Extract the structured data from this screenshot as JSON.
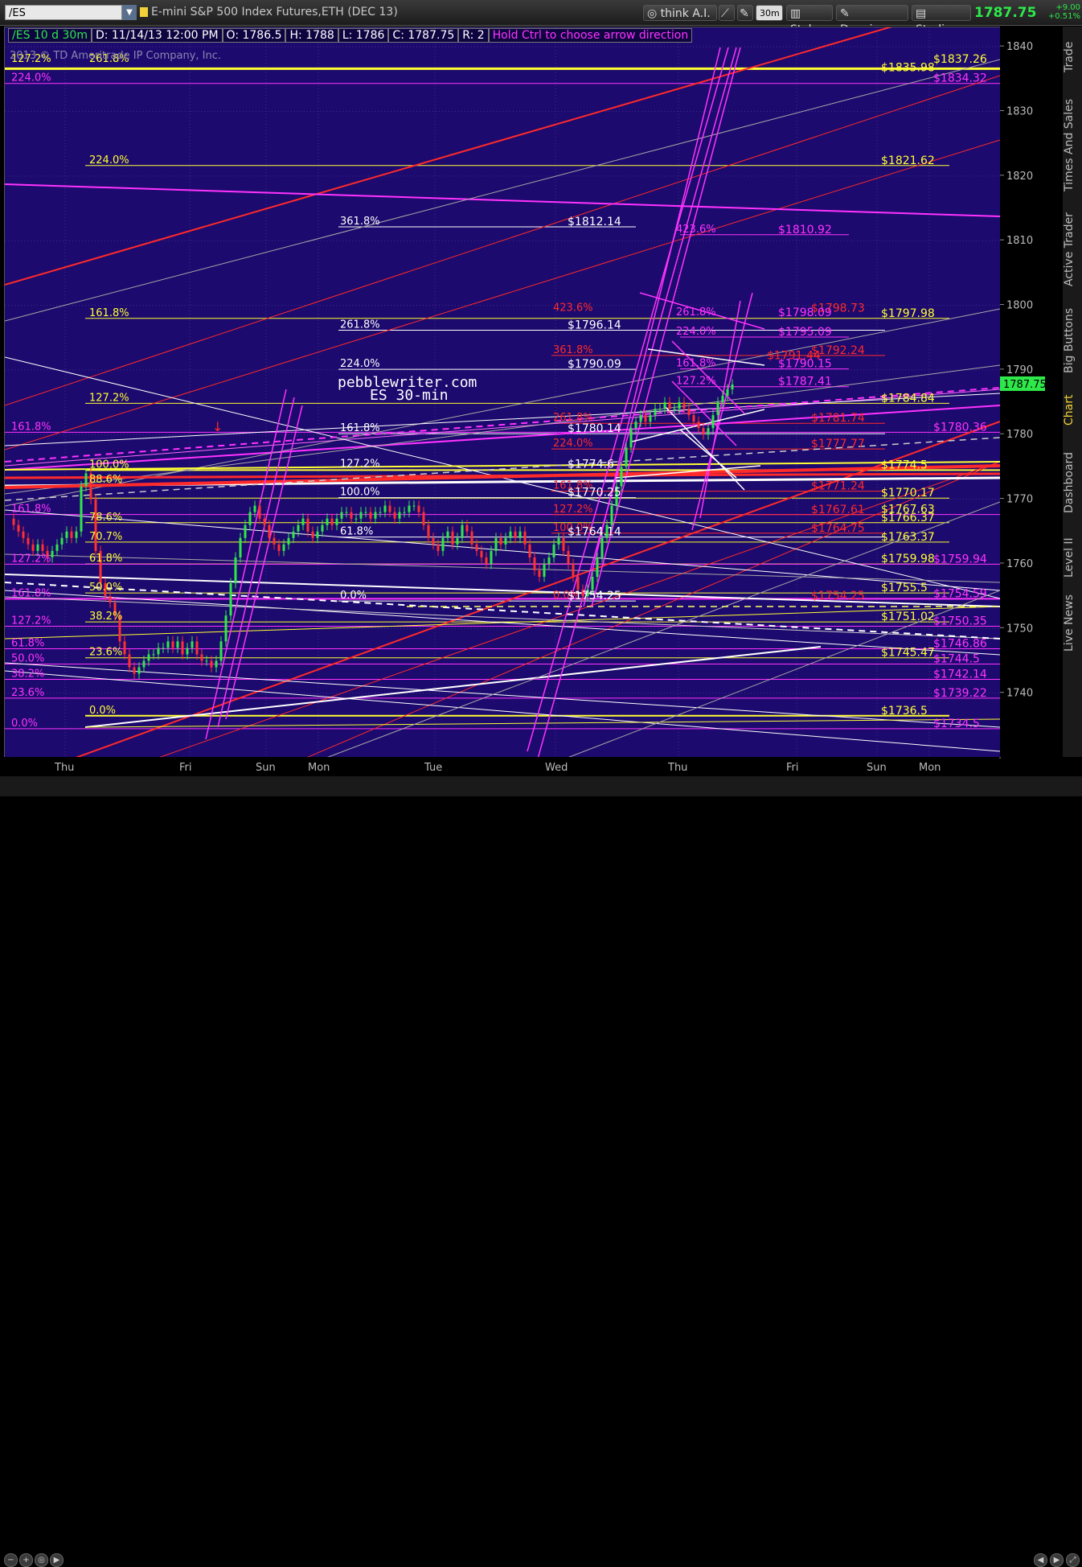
{
  "toolbar": {
    "symbol": "/ES",
    "instrument_title": "E-mini S&P 500 Index Futures,ETH (DEC 13)",
    "think_ai": "think A.I.",
    "zoom": "30m",
    "style": "Style",
    "drawings": "Drawings",
    "studies": "Studies",
    "last_price": "1787.75",
    "change": "+9.00",
    "change_pct": "+0.51%"
  },
  "info_bar": {
    "symbol_period": "/ES 10 d 30m",
    "date": "D: 11/14/13 12:00 PM",
    "open": "O: 1786.5",
    "high": "H: 1788",
    "low": "L: 1786",
    "close": "C: 1787.75",
    "range": "R: 2",
    "hint": "Hold Ctrl to choose arrow direction"
  },
  "copyright": "2013 © TD Ameritrade IP Company, Inc.",
  "watermark": {
    "line1": "pebblewriter.com",
    "line2": "ES 30-min"
  },
  "right_tabs": [
    "Trade",
    "Times And Sales",
    "Active Trader",
    "Big Buttons",
    "Chart",
    "Dashboard",
    "Level II",
    "Live News"
  ],
  "colors": {
    "background": "#1d0a6e",
    "yellow": "#ffff33",
    "magenta": "#ff33ff",
    "red": "#ff2a2a",
    "white": "#ffffff",
    "gray": "#a8a8a8",
    "price_tag": "#2ee84a"
  },
  "chart_data": {
    "type": "candlestick",
    "title": "/ES 10 d 30m",
    "ylim": [
      1730,
      1843
    ],
    "y_ticks": [
      1740,
      1750,
      1760,
      1770,
      1780,
      1790,
      1800,
      1810,
      1820,
      1830,
      1840
    ],
    "x_ticks": [
      "Thu",
      "Fri",
      "Sun",
      "Mon",
      "Tue",
      "Wed",
      "Thu",
      "Fri",
      "Sun",
      "Mon"
    ],
    "last_price_tag": 1787.75,
    "closes": [
      1767,
      1766,
      1765,
      1764,
      1763,
      1762,
      1763,
      1762,
      1761,
      1762,
      1763,
      1764,
      1765,
      1764,
      1765,
      1772,
      1774,
      1770,
      1762,
      1757,
      1755,
      1754,
      1752,
      1748,
      1746,
      1744,
      1743,
      1744,
      1745,
      1746,
      1746,
      1747,
      1747,
      1748,
      1747,
      1748,
      1746,
      1747,
      1748,
      1746,
      1745,
      1745,
      1744,
      1745,
      1748,
      1752,
      1757,
      1761,
      1764,
      1766,
      1768,
      1769,
      1767,
      1766,
      1764,
      1763,
      1762,
      1763,
      1764,
      1765,
      1766,
      1767,
      1765,
      1764,
      1765,
      1766,
      1767,
      1766,
      1767,
      1768,
      1768,
      1767,
      1767,
      1768,
      1768,
      1767,
      1768,
      1768,
      1769,
      1768,
      1767,
      1768,
      1768,
      1769,
      1769,
      1768,
      1766,
      1764,
      1763,
      1762,
      1764,
      1765,
      1763,
      1764,
      1766,
      1765,
      1763,
      1762,
      1761,
      1760,
      1762,
      1764,
      1763,
      1764,
      1765,
      1764,
      1765,
      1763,
      1761,
      1759,
      1758,
      1760,
      1761,
      1763,
      1764,
      1762,
      1760,
      1758,
      1756,
      1755,
      1756,
      1758,
      1761,
      1764,
      1766,
      1769,
      1772,
      1775,
      1778,
      1781,
      1782,
      1783,
      1782,
      1783,
      1784,
      1784,
      1785,
      1784,
      1784,
      1785,
      1784,
      1783,
      1782,
      1781,
      1780,
      1781,
      1783,
      1785,
      1786,
      1787,
      1787.75
    ],
    "series": [
      {
        "name": "fib-yellow-left",
        "labels": [
          {
            "text": "127.2%",
            "price": 1837.3
          },
          {
            "text": "261.8%",
            "price": 1837.3
          },
          {
            "text": "224.0%",
            "price": 1821.6
          },
          {
            "text": "161.8%",
            "price": 1797.98
          },
          {
            "text": "127.2%",
            "price": 1784.84
          },
          {
            "text": "100.0%",
            "price": 1774.5
          },
          {
            "text": "88.6%",
            "price": 1772.2
          },
          {
            "text": "78.6%",
            "price": 1766.37
          },
          {
            "text": "70.7%",
            "price": 1763.37
          },
          {
            "text": "61.8%",
            "price": 1759.98
          },
          {
            "text": "50.0%",
            "price": 1755.5
          },
          {
            "text": "38.2%",
            "price": 1751.02
          },
          {
            "text": "23.6%",
            "price": 1745.47
          },
          {
            "text": "0.0%",
            "price": 1736.5
          }
        ]
      },
      {
        "name": "fib-white-mid",
        "labels": [
          {
            "text": "361.8%",
            "price": 1812.14
          },
          {
            "text": "261.8%",
            "price": 1796.14
          },
          {
            "text": "224.0%",
            "price": 1790.09
          },
          {
            "text": "161.8%",
            "price": 1780.14
          },
          {
            "text": "127.2%",
            "price": 1774.6
          },
          {
            "text": "100.0%",
            "price": 1770.25
          },
          {
            "text": "61.8%",
            "price": 1764.14
          },
          {
            "text": "0.0%",
            "price": 1754.25
          }
        ]
      },
      {
        "name": "fib-magenta-left",
        "labels": [
          {
            "text": "224.0%",
            "price": 1834.32
          },
          {
            "text": "161.8%",
            "price": 1780.36
          },
          {
            "text": "161.8%",
            "price": 1767.63
          },
          {
            "text": "127.2%",
            "price": 1759.94
          },
          {
            "text": "161.8%",
            "price": 1754.59
          },
          {
            "text": "127.2%",
            "price": 1750.35
          },
          {
            "text": "61.8%",
            "price": 1746.86
          },
          {
            "text": "50.0%",
            "price": 1744.5
          },
          {
            "text": "38.2%",
            "price": 1742.14
          },
          {
            "text": "23.6%",
            "price": 1739.22
          },
          {
            "text": "0.0%",
            "price": 1734.5
          }
        ]
      },
      {
        "name": "fib-red-right",
        "labels": [
          {
            "text": "423.6%",
            "price": 1798.73
          },
          {
            "text": "361.8%",
            "price": 1792.24
          },
          {
            "text": "261.8%",
            "price": 1781.74
          },
          {
            "text": "224.0%",
            "price": 1777.77
          },
          {
            "text": "161.8%",
            "price": 1771.24
          },
          {
            "text": "127.2%",
            "price": 1767.61
          },
          {
            "text": "100.0%",
            "price": 1764.75
          },
          {
            "text": "0.0%",
            "price": 1754.25
          }
        ]
      },
      {
        "name": "fib-magenta-right",
        "labels": [
          {
            "text": "423.6%",
            "price": 1810.92
          },
          {
            "text": "261.8%",
            "price": 1798.09
          },
          {
            "text": "224.0%",
            "price": 1795.09
          },
          {
            "text": "161.8%",
            "price": 1790.15
          },
          {
            "text": "127.2%",
            "price": 1787.41
          }
        ]
      }
    ],
    "price_labels": [
      {
        "text": "$1837.26",
        "price": 1837.26,
        "color": "yellow"
      },
      {
        "text": "$1835.98",
        "price": 1835.98,
        "color": "yellow"
      },
      {
        "text": "$1834.32",
        "price": 1834.32,
        "color": "magenta"
      },
      {
        "text": "$1821.62",
        "price": 1821.62,
        "color": "yellow"
      },
      {
        "text": "$1812.14",
        "price": 1812.14,
        "color": "white"
      },
      {
        "text": "$1810.92",
        "price": 1810.92,
        "color": "magenta"
      },
      {
        "text": "$1798.73",
        "price": 1798.73,
        "color": "red"
      },
      {
        "text": "$1798.09",
        "price": 1798.09,
        "color": "magenta"
      },
      {
        "text": "$1797.98",
        "price": 1797.98,
        "color": "yellow"
      },
      {
        "text": "$1796.14",
        "price": 1796.14,
        "color": "white"
      },
      {
        "text": "$1795.09",
        "price": 1795.09,
        "color": "magenta"
      },
      {
        "text": "$1792.24",
        "price": 1792.24,
        "color": "red"
      },
      {
        "text": "$1791.44",
        "price": 1791.44,
        "color": "red"
      },
      {
        "text": "$1790.15",
        "price": 1790.15,
        "color": "magenta"
      },
      {
        "text": "$1790.09",
        "price": 1790.09,
        "color": "white"
      },
      {
        "text": "$1787.41",
        "price": 1787.41,
        "color": "magenta"
      },
      {
        "text": "$1784.84",
        "price": 1784.84,
        "color": "yellow"
      },
      {
        "text": "$1781.74",
        "price": 1781.74,
        "color": "red"
      },
      {
        "text": "$1780.36",
        "price": 1780.36,
        "color": "magenta"
      },
      {
        "text": "$1780.14",
        "price": 1780.14,
        "color": "white"
      },
      {
        "text": "$1777.77",
        "price": 1777.77,
        "color": "red"
      },
      {
        "text": "$1774.6",
        "price": 1774.6,
        "color": "white"
      },
      {
        "text": "$1774.5",
        "price": 1774.5,
        "color": "yellow"
      },
      {
        "text": "$1771.24",
        "price": 1771.24,
        "color": "red"
      },
      {
        "text": "$1770.25",
        "price": 1770.25,
        "color": "white"
      },
      {
        "text": "$1770.17",
        "price": 1770.17,
        "color": "yellow"
      },
      {
        "text": "$1767.63",
        "price": 1767.63,
        "color": "yellow"
      },
      {
        "text": "$1767.61",
        "price": 1767.61,
        "color": "red"
      },
      {
        "text": "$1766.37",
        "price": 1766.37,
        "color": "yellow"
      },
      {
        "text": "$1764.75",
        "price": 1764.75,
        "color": "red"
      },
      {
        "text": "$1764.14",
        "price": 1764.14,
        "color": "white"
      },
      {
        "text": "$1763.37",
        "price": 1763.37,
        "color": "yellow"
      },
      {
        "text": "$1759.98",
        "price": 1759.98,
        "color": "yellow"
      },
      {
        "text": "$1759.94",
        "price": 1759.94,
        "color": "magenta"
      },
      {
        "text": "$1755.5",
        "price": 1755.5,
        "color": "yellow"
      },
      {
        "text": "$1754.59",
        "price": 1754.59,
        "color": "magenta"
      },
      {
        "text": "$1754.25",
        "price": 1754.25,
        "color": "white"
      },
      {
        "text": "$1754.25",
        "price": 1754.25,
        "color": "red"
      },
      {
        "text": "$1751.02",
        "price": 1751.02,
        "color": "yellow"
      },
      {
        "text": "$1750.35",
        "price": 1750.35,
        "color": "magenta"
      },
      {
        "text": "$1746.86",
        "price": 1746.86,
        "color": "magenta"
      },
      {
        "text": "$1745.47",
        "price": 1745.47,
        "color": "yellow"
      },
      {
        "text": "$1744.5",
        "price": 1744.5,
        "color": "magenta"
      },
      {
        "text": "$1742.14",
        "price": 1742.14,
        "color": "magenta"
      },
      {
        "text": "$1739.22",
        "price": 1739.22,
        "color": "magenta"
      },
      {
        "text": "$1736.5",
        "price": 1736.5,
        "color": "yellow"
      },
      {
        "text": "$1734.5",
        "price": 1734.5,
        "color": "magenta"
      }
    ]
  }
}
